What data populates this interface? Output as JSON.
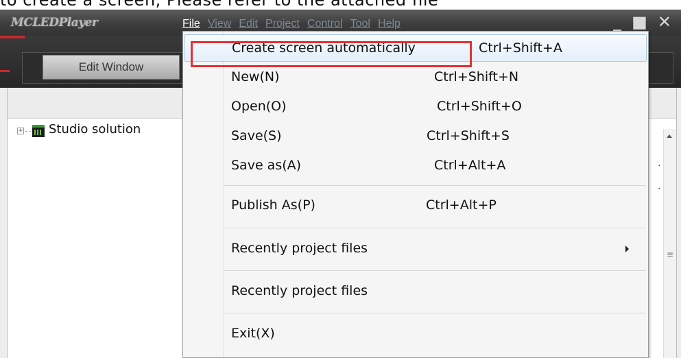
{
  "cut_text": "to create a screen, Please refer to the attached file",
  "window": {
    "title": "MCLEDPlayer",
    "menubar": [
      "File",
      "View",
      "Edit",
      "Project",
      "Control",
      "Tool",
      "Help"
    ],
    "controls": {
      "minimize": "_",
      "maximize": "■",
      "close": "✕"
    }
  },
  "toolbar": {
    "edit_window_tab": "Edit Window"
  },
  "tree": {
    "root_label": "Studio solution",
    "expander": "+"
  },
  "file_menu": {
    "items": [
      {
        "label": "Create screen automatically",
        "shortcut": "Ctrl+Shift+A"
      },
      {
        "label": "New(N)",
        "shortcut": "Ctrl+Shift+N"
      },
      {
        "label": "Open(O)",
        "shortcut": "Ctrl+Shift+O"
      },
      {
        "label": "Save(S)",
        "shortcut": "Ctrl+Shift+S"
      },
      {
        "label": "Save as(A)",
        "shortcut": "Ctrl+Alt+A"
      },
      {
        "label": "Publish As(P)",
        "shortcut": "Ctrl+Alt+P"
      },
      {
        "label": "Recently project files",
        "shortcut": ""
      },
      {
        "label": "Recently project files",
        "shortcut": ""
      },
      {
        "label": "Exit(X)",
        "shortcut": ""
      }
    ]
  },
  "colors": {
    "highlight_box": "#e53033",
    "titlebar": "#3d3d3d"
  }
}
